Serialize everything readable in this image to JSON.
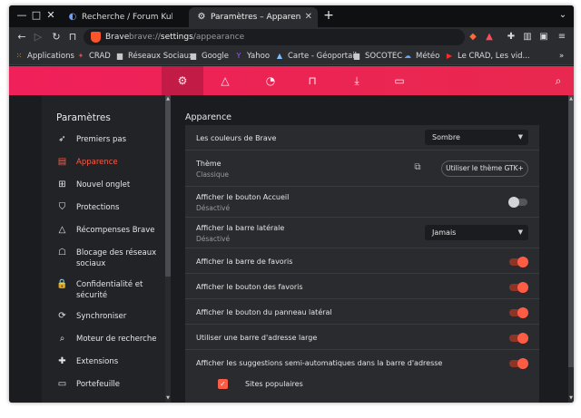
{
  "browser": {
    "window_controls": {
      "minimize": "—",
      "maximize": "□",
      "close": "✕"
    },
    "tabs": [
      {
        "label": "Recherche / Forum Kubuntu-fr.o",
        "close": "✕",
        "active": false
      },
      {
        "label": "Paramètres – Apparence",
        "close": "✕",
        "active": true
      }
    ],
    "newtab": "+",
    "tab_menu": "⌄"
  },
  "toolbar": {
    "back": "←",
    "forward": "▷",
    "reload": "↻",
    "bookmark": "🔖",
    "site_name": "Brave",
    "url_prefix": "brave://",
    "url_bold": "settings",
    "url_suffix": "/appearance"
  },
  "bookmarks": [
    {
      "label": "Applications",
      "icon": "grid-icon"
    },
    {
      "label": "CRAD",
      "icon": "crad-icon"
    },
    {
      "label": "Réseaux Sociaux",
      "icon": "folder-icon"
    },
    {
      "label": "Google",
      "icon": "folder-icon"
    },
    {
      "label": "Yahoo",
      "icon": "yahoo-icon"
    },
    {
      "label": "Carte - Géoportail",
      "icon": "map-icon"
    },
    {
      "label": "SOCOTEC",
      "icon": "folder-icon"
    },
    {
      "label": "Météo",
      "icon": "meteo-icon"
    },
    {
      "label": "Le CRAD, Les vid...",
      "icon": "youtube-icon"
    }
  ],
  "sidebar": {
    "title": "Paramètres",
    "items": [
      {
        "label": "Premiers pas",
        "icon": "rocket-icon",
        "active": false
      },
      {
        "label": "Apparence",
        "icon": "appearance-icon",
        "active": true
      },
      {
        "label": "Nouvel onglet",
        "icon": "new-tab-icon",
        "active": false
      },
      {
        "label": "Protections",
        "icon": "shield-icon",
        "active": false
      },
      {
        "label": "Récompenses Brave",
        "icon": "rewards-icon",
        "active": false
      },
      {
        "label": "Blocage des réseaux sociaux",
        "icon": "social-block-icon",
        "active": false
      },
      {
        "label": "Confidentialité et sécurité",
        "icon": "lock-icon",
        "active": false
      },
      {
        "label": "Synchroniser",
        "icon": "sync-icon",
        "active": false
      },
      {
        "label": "Moteur de recherche",
        "icon": "search-icon",
        "active": false
      },
      {
        "label": "Extensions",
        "icon": "puzzle-icon",
        "active": false
      },
      {
        "label": "Portefeuille",
        "icon": "wallet-icon",
        "active": false
      }
    ]
  },
  "main": {
    "section_title": "Apparence",
    "colors": {
      "label": "Les couleurs de Brave",
      "value": "Sombre"
    },
    "theme": {
      "label": "Thème",
      "sub": "Classique",
      "button": "Utiliser le thème GTK+"
    },
    "home_button": {
      "label": "Afficher le bouton Accueil",
      "sub": "Désactivé",
      "on": false
    },
    "sidebar_setting": {
      "label": "Afficher la barre latérale",
      "sub": "Désactivé",
      "value": "Jamais"
    },
    "toggles": [
      {
        "label": "Afficher la barre de favoris",
        "on": true
      },
      {
        "label": "Afficher le bouton des favoris",
        "on": true
      },
      {
        "label": "Afficher le bouton du panneau latéral",
        "on": true
      },
      {
        "label": "Utiliser une barre d'adresse large",
        "on": true
      },
      {
        "label": "Afficher les suggestions semi-automatiques dans la barre d'adresse",
        "on": true
      }
    ],
    "popular_sites": {
      "label": "Sites populaires",
      "checked": true
    }
  },
  "colors": {
    "accent": "#ff5c45",
    "header_gradient_start": "#f0205a",
    "background": "#1b1c1f",
    "card": "#2a2b2f"
  }
}
